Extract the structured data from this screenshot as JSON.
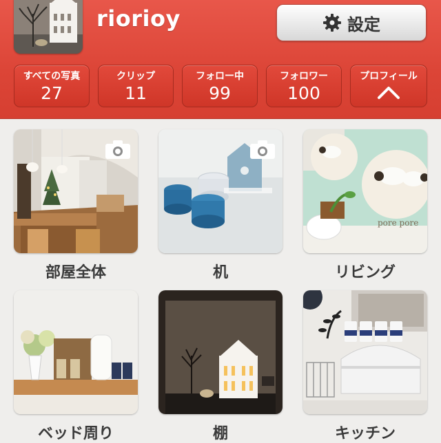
{
  "profile": {
    "username": "riorioy",
    "avatar_icon": "avatar-photo"
  },
  "settings": {
    "label": "設定",
    "icon": "gear-icon"
  },
  "stats": [
    {
      "label": "すべての写真",
      "value": "27"
    },
    {
      "label": "クリップ",
      "value": "11"
    },
    {
      "label": "フォロー中",
      "value": "99"
    },
    {
      "label": "フォロワー",
      "value": "100"
    },
    {
      "label": "プロフィール",
      "icon": "chevron-up-icon"
    }
  ],
  "photos": [
    {
      "caption": "部屋全体",
      "camera_badge": true
    },
    {
      "caption": "机",
      "camera_badge": true
    },
    {
      "caption": "リビング",
      "camera_badge": false,
      "overlay_text": "pore pore"
    },
    {
      "caption": "ベッド周り",
      "camera_badge": false
    },
    {
      "caption": "棚",
      "camera_badge": false
    },
    {
      "caption": "キッチン",
      "camera_badge": false
    }
  ],
  "colors": {
    "header": "#dc4537",
    "stat_button": "#d63e30",
    "background": "#efeeec"
  }
}
